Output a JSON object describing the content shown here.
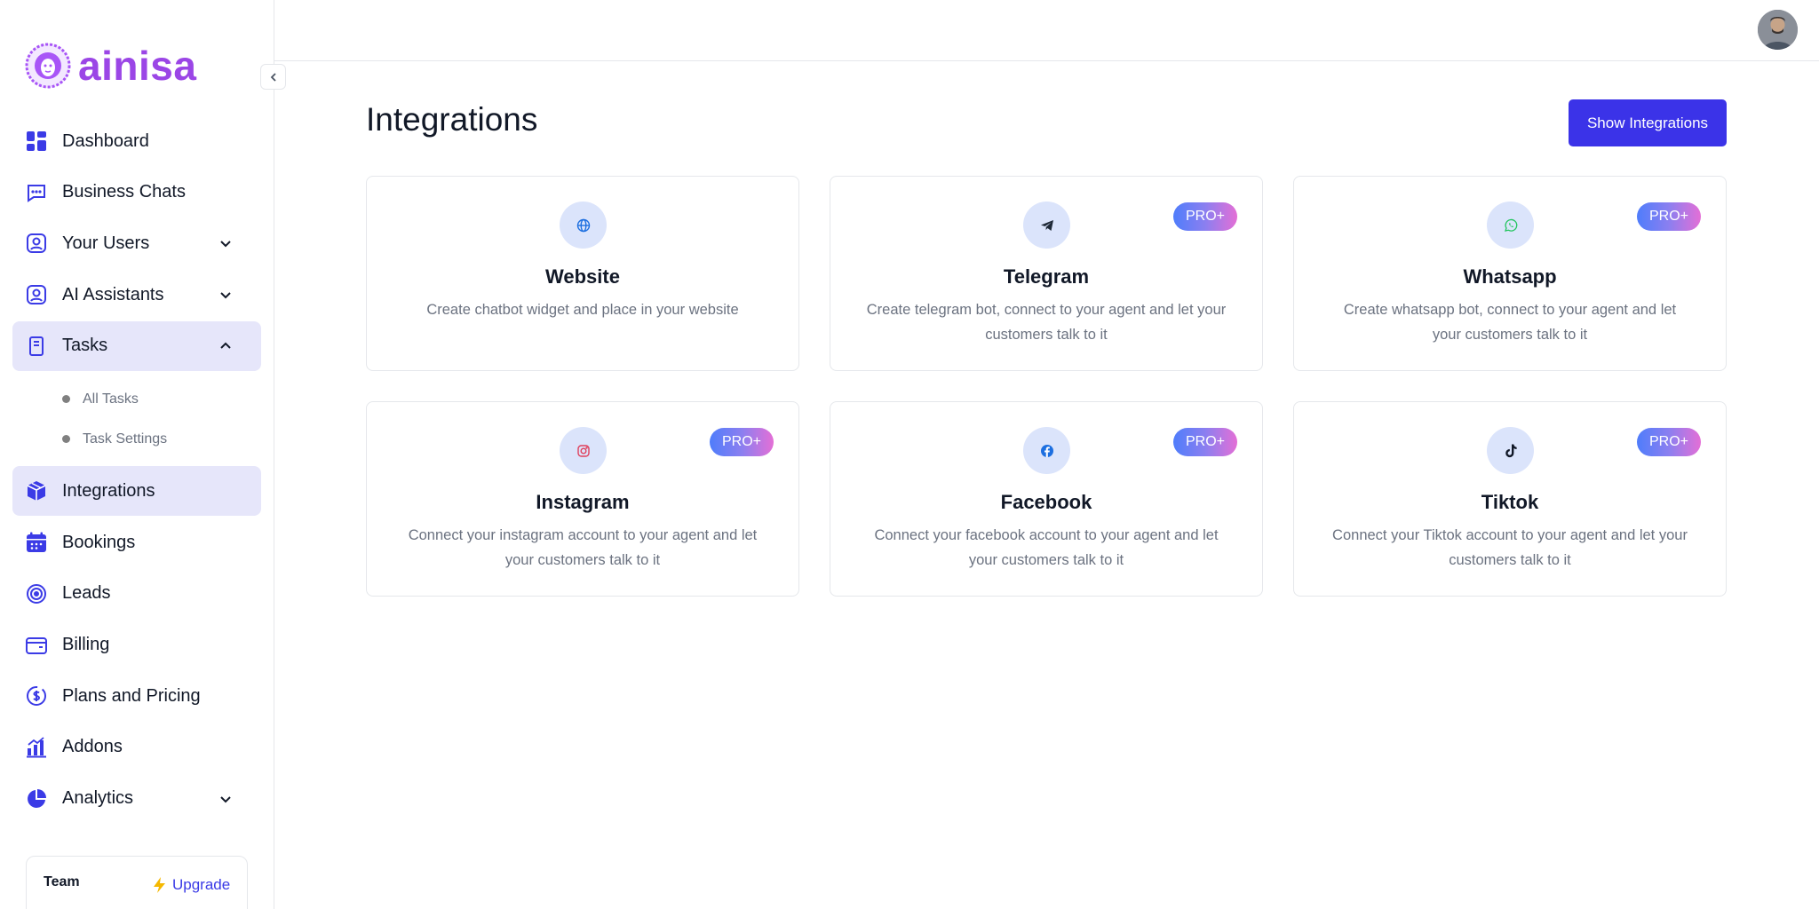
{
  "app": {
    "logo_text": "ainisa",
    "brand_color": "#9b46e6",
    "accent_color": "#3b33e8"
  },
  "sidebar": {
    "items": [
      {
        "label": "Dashboard",
        "icon": "dashboard-grid-icon"
      },
      {
        "label": "Business Chats",
        "icon": "chat-icon"
      },
      {
        "label": "Your Users",
        "icon": "user-icon",
        "expandable": true
      },
      {
        "label": "AI Assistants",
        "icon": "user-icon",
        "expandable": true
      },
      {
        "label": "Tasks",
        "icon": "clipboard-icon",
        "expandable": true,
        "expanded": true
      },
      {
        "label": "Integrations",
        "icon": "cube-icon",
        "active": true
      },
      {
        "label": "Bookings",
        "icon": "calendar-icon"
      },
      {
        "label": "Leads",
        "icon": "target-icon"
      },
      {
        "label": "Billing",
        "icon": "wallet-icon"
      },
      {
        "label": "Plans and Pricing",
        "icon": "dollar-icon"
      },
      {
        "label": "Addons",
        "icon": "bar-chart-icon"
      },
      {
        "label": "Analytics",
        "icon": "pie-chart-icon",
        "expandable": true
      }
    ],
    "tasks_subitems": [
      "All Tasks",
      "Task Settings"
    ],
    "team": {
      "name": "Team",
      "upgrade_label": "Upgrade"
    }
  },
  "main": {
    "title": "Integrations",
    "show_button": "Show Integrations",
    "integrations": [
      {
        "name": "Website",
        "description": "Create chatbot widget and place in your website",
        "icon": "globe-icon",
        "pro": false
      },
      {
        "name": "Telegram",
        "description": "Create telegram bot, connect to your agent and let your customers talk to it",
        "icon": "telegram-icon",
        "pro": true
      },
      {
        "name": "Whatsapp",
        "description": "Create whatsapp bot, connect to your agent and let your customers talk to it",
        "icon": "whatsapp-icon",
        "pro": true
      },
      {
        "name": "Instagram",
        "description": "Connect your instagram account to your agent and let your customers talk to it",
        "icon": "instagram-icon",
        "pro": true
      },
      {
        "name": "Facebook",
        "description": "Connect your facebook account to your agent and let your customers talk to it",
        "icon": "facebook-icon",
        "pro": true
      },
      {
        "name": "Tiktok",
        "description": "Connect your Tiktok account to your agent and let your customers talk to it",
        "icon": "tiktok-icon",
        "pro": true
      }
    ],
    "pro_badge": "PRO+"
  }
}
